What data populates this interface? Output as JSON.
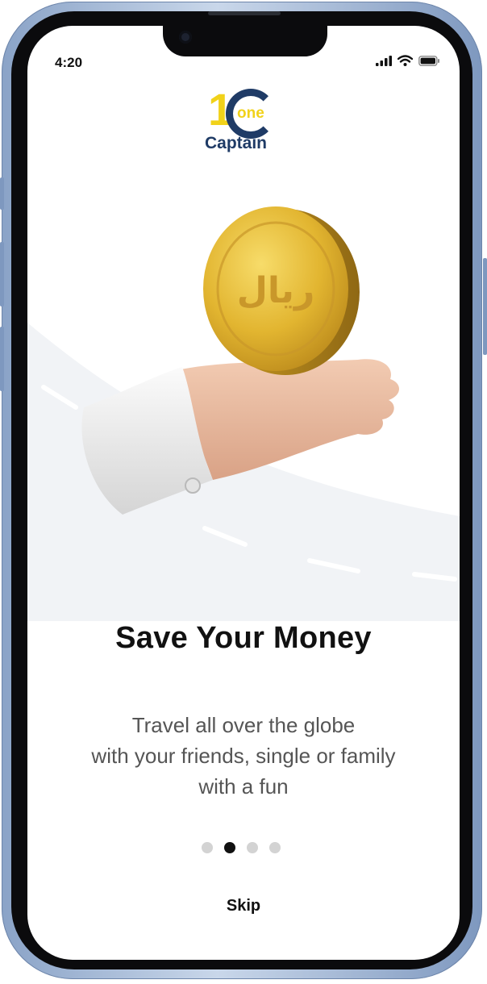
{
  "status_bar": {
    "time": "4:20"
  },
  "logo": {
    "numeral": "1",
    "one": "one",
    "name": "Captain"
  },
  "coin": {
    "glyph": "ريال"
  },
  "onboarding": {
    "title": "Save Your Money",
    "description_lines": [
      "Travel all over the globe",
      "with your friends,  single or family",
      "with a fun"
    ],
    "page_index": 1,
    "page_count": 4,
    "skip_label": "Skip"
  },
  "colors": {
    "brand_blue": "#1f3b66",
    "brand_yellow": "#f1d21a",
    "coin_gold": "#d9a91f",
    "active_dot": "#111111",
    "inactive_dot": "#d3d3d3"
  }
}
